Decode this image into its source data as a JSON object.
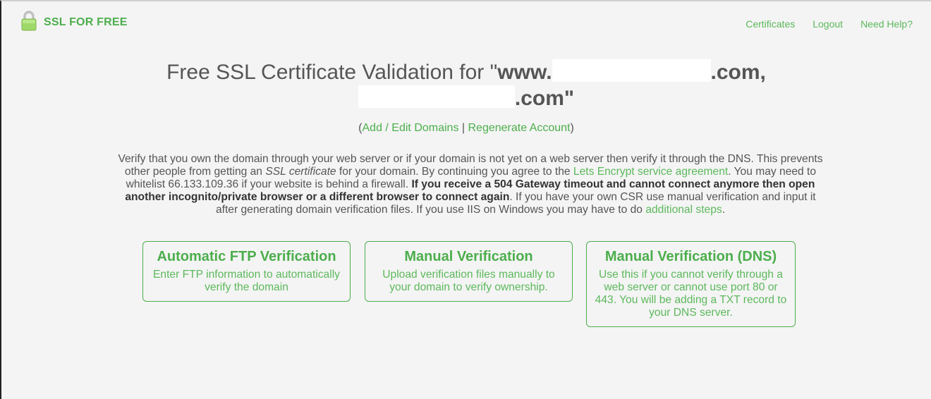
{
  "header": {
    "logo_text": "SSL FOR FREE",
    "logo_icon": "padlock-icon",
    "nav": [
      {
        "label": "Certificates"
      },
      {
        "label": "Logout"
      },
      {
        "label": "Need Help?"
      }
    ]
  },
  "title": {
    "prefix": "Free SSL Certificate Validation for \"",
    "domain1_start": "www.",
    "domain1_end": ".com,",
    "domain2_end": ".com\""
  },
  "links": {
    "open_paren": "(",
    "add_edit": "Add / Edit Domains",
    "separator": " | ",
    "regenerate": "Regenerate Account",
    "close_paren": ")"
  },
  "description": {
    "part1": "Verify that you own the domain through your web server or if your domain is not yet on a web server then verify it through the DNS. This prevents other people from getting an ",
    "ssl_em": "SSL certificate",
    "part2": " for your domain. By continuing you agree to the ",
    "agreement_link": "Lets Encrypt service agreement",
    "part3": ". You may need to whitelist 66.133.109.36 if your website is behind a firewall. ",
    "bold": "If you receive a 504 Gateway timeout and cannot connect anymore then open another incognito/private browser or a different browser to connect again",
    "part4": ". If you have your own CSR use manual verification and input it after generating domain verification files. If you use IIS on Windows you may have to do ",
    "steps_link": "additional steps",
    "part5": "."
  },
  "options": [
    {
      "title": "Automatic FTP Verification",
      "description": "Enter FTP information to automatically verify the domain"
    },
    {
      "title": "Manual Verification",
      "description": "Upload verification files manually to your domain to verify ownership."
    },
    {
      "title": "Manual Verification (DNS)",
      "description": "Use this if you cannot verify through a web server or cannot use port 80 or 443. You will be adding a TXT record to your DNS server."
    }
  ],
  "colors": {
    "brand_green": "#4cae4c",
    "link_green": "#5cb85c",
    "text": "#555555",
    "background": "#f4f4f4"
  }
}
